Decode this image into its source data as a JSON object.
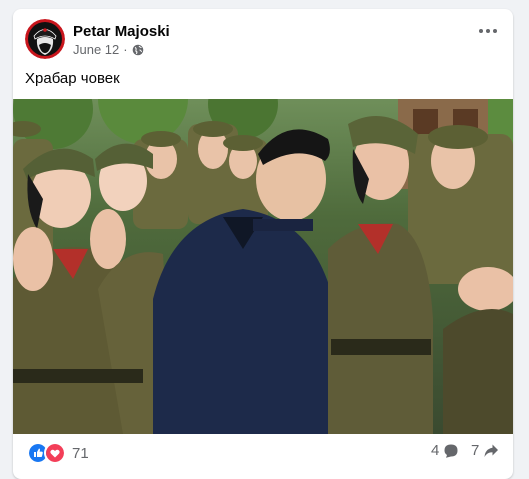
{
  "post": {
    "author": "Petar Majoski",
    "date": "June 12",
    "separator": "·",
    "audience_icon": "globe-icon",
    "caption": "Храбар човек"
  },
  "stats": {
    "reactions_count": "71",
    "comments_count": "4",
    "shares_count": "7",
    "reaction_icons": [
      "like-icon",
      "love-icon"
    ]
  },
  "colors": {
    "like_blue": "#1877f2",
    "love_red": "#f33e58",
    "avatar_red": "#c8161d",
    "background": "#f0f2f5"
  }
}
